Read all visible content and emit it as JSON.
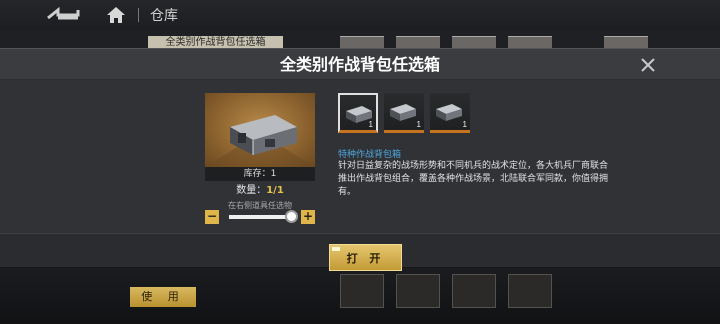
{
  "background": {
    "nav": {
      "back_icon": "back-arrow-icon",
      "home_icon": "home-icon",
      "title": "仓库"
    },
    "item_label": "全类别作战背包任选箱",
    "use_button": "使 用",
    "card_counts": [
      "",
      "",
      "",
      ""
    ]
  },
  "modal": {
    "title": "全类别作战背包任选箱",
    "close_icon": "close-icon",
    "preview": {
      "stock_label": "库存：1",
      "quantity_label": "数量：",
      "quantity_value": "1/1",
      "hint": "在右侧道具任选物",
      "slider_fraction": 1.0,
      "minus": "−",
      "plus": "+"
    },
    "options": [
      {
        "count": "1",
        "selected": true
      },
      {
        "count": "1",
        "selected": false
      },
      {
        "count": "1",
        "selected": false
      }
    ],
    "description": {
      "title": "特种作战背包箱",
      "text": "针对日益复杂的战场形势和不同机兵的战术定位，各大机兵厂商联合推出作战背包组合，覆盖各种作战场景，北陆联合军同款，你值得拥有。"
    },
    "open_button": "打 开"
  },
  "colors": {
    "accent_gold": "#e0b54a",
    "option_border": "#c8731f",
    "description_title": "#4fa6dd",
    "quantity_value": "#e6c24d"
  }
}
